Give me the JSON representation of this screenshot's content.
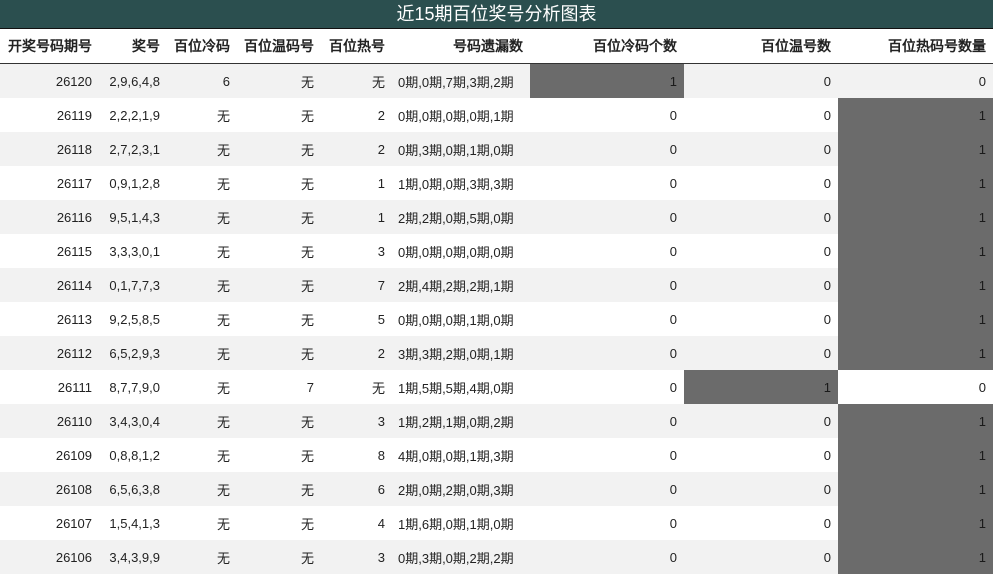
{
  "title": "近15期百位奖号分析图表",
  "headers": [
    "开奖号码期号",
    "奖号",
    "百位冷码",
    "百位温码号",
    "百位热号",
    "号码遗漏数",
    "百位冷码个数",
    "百位温号数",
    "百位热码号数量"
  ],
  "rows": [
    {
      "issue": "26120",
      "numbers": "2,9,6,4,8",
      "cold": "6",
      "warm": "无",
      "hot": "无",
      "missing": "0期,0期,7期,3期,2期",
      "cold_count": "1",
      "warm_count": "0",
      "hot_count": "0",
      "highlight": "cold"
    },
    {
      "issue": "26119",
      "numbers": "2,2,2,1,9",
      "cold": "无",
      "warm": "无",
      "hot": "2",
      "missing": "0期,0期,0期,0期,1期",
      "cold_count": "0",
      "warm_count": "0",
      "hot_count": "1",
      "highlight": "hot"
    },
    {
      "issue": "26118",
      "numbers": "2,7,2,3,1",
      "cold": "无",
      "warm": "无",
      "hot": "2",
      "missing": "0期,3期,0期,1期,0期",
      "cold_count": "0",
      "warm_count": "0",
      "hot_count": "1",
      "highlight": "hot"
    },
    {
      "issue": "26117",
      "numbers": "0,9,1,2,8",
      "cold": "无",
      "warm": "无",
      "hot": "1",
      "missing": "1期,0期,0期,3期,3期",
      "cold_count": "0",
      "warm_count": "0",
      "hot_count": "1",
      "highlight": "hot"
    },
    {
      "issue": "26116",
      "numbers": "9,5,1,4,3",
      "cold": "无",
      "warm": "无",
      "hot": "1",
      "missing": "2期,2期,0期,5期,0期",
      "cold_count": "0",
      "warm_count": "0",
      "hot_count": "1",
      "highlight": "hot"
    },
    {
      "issue": "26115",
      "numbers": "3,3,3,0,1",
      "cold": "无",
      "warm": "无",
      "hot": "3",
      "missing": "0期,0期,0期,0期,0期",
      "cold_count": "0",
      "warm_count": "0",
      "hot_count": "1",
      "highlight": "hot"
    },
    {
      "issue": "26114",
      "numbers": "0,1,7,7,3",
      "cold": "无",
      "warm": "无",
      "hot": "7",
      "missing": "2期,4期,2期,2期,1期",
      "cold_count": "0",
      "warm_count": "0",
      "hot_count": "1",
      "highlight": "hot"
    },
    {
      "issue": "26113",
      "numbers": "9,2,5,8,5",
      "cold": "无",
      "warm": "无",
      "hot": "5",
      "missing": "0期,0期,0期,1期,0期",
      "cold_count": "0",
      "warm_count": "0",
      "hot_count": "1",
      "highlight": "hot"
    },
    {
      "issue": "26112",
      "numbers": "6,5,2,9,3",
      "cold": "无",
      "warm": "无",
      "hot": "2",
      "missing": "3期,3期,2期,0期,1期",
      "cold_count": "0",
      "warm_count": "0",
      "hot_count": "1",
      "highlight": "hot"
    },
    {
      "issue": "26111",
      "numbers": "8,7,7,9,0",
      "cold": "无",
      "warm": "7",
      "hot": "无",
      "missing": "1期,5期,5期,4期,0期",
      "cold_count": "0",
      "warm_count": "1",
      "hot_count": "0",
      "highlight": "warm"
    },
    {
      "issue": "26110",
      "numbers": "3,4,3,0,4",
      "cold": "无",
      "warm": "无",
      "hot": "3",
      "missing": "1期,2期,1期,0期,2期",
      "cold_count": "0",
      "warm_count": "0",
      "hot_count": "1",
      "highlight": "hot"
    },
    {
      "issue": "26109",
      "numbers": "0,8,8,1,2",
      "cold": "无",
      "warm": "无",
      "hot": "8",
      "missing": "4期,0期,0期,1期,3期",
      "cold_count": "0",
      "warm_count": "0",
      "hot_count": "1",
      "highlight": "hot"
    },
    {
      "issue": "26108",
      "numbers": "6,5,6,3,8",
      "cold": "无",
      "warm": "无",
      "hot": "6",
      "missing": "2期,0期,2期,0期,3期",
      "cold_count": "0",
      "warm_count": "0",
      "hot_count": "1",
      "highlight": "hot"
    },
    {
      "issue": "26107",
      "numbers": "1,5,4,1,3",
      "cold": "无",
      "warm": "无",
      "hot": "4",
      "missing": "1期,6期,0期,1期,0期",
      "cold_count": "0",
      "warm_count": "0",
      "hot_count": "1",
      "highlight": "hot"
    },
    {
      "issue": "26106",
      "numbers": "3,4,3,9,9",
      "cold": "无",
      "warm": "无",
      "hot": "3",
      "missing": "0期,3期,0期,2期,2期",
      "cold_count": "0",
      "warm_count": "0",
      "hot_count": "1",
      "highlight": "hot"
    }
  ],
  "colors": {
    "title_bg": "#2b4f4f",
    "highlight": "#6b6b6b",
    "row_stripe": "#f2f2f2"
  }
}
